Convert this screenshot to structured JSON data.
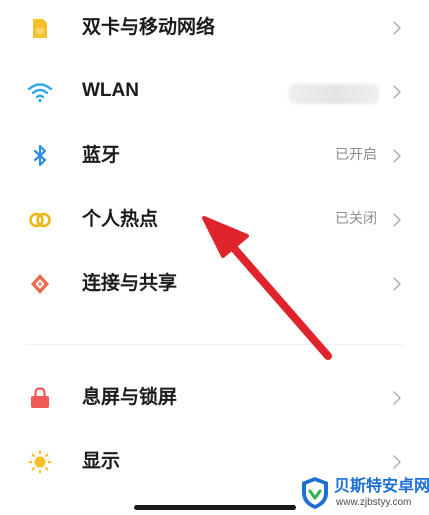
{
  "settings": {
    "items": [
      {
        "label": "双卡与移动网络",
        "status": "",
        "icon": "sim-card-icon"
      },
      {
        "label": "WLAN",
        "status": "",
        "icon": "wifi-icon"
      },
      {
        "label": "蓝牙",
        "status": "已开启",
        "icon": "bluetooth-icon"
      },
      {
        "label": "个人热点",
        "status": "已关闭",
        "icon": "hotspot-icon"
      },
      {
        "label": "连接与共享",
        "status": "",
        "icon": "connection-sharing-icon"
      },
      {
        "label": "息屏与锁屏",
        "status": "",
        "icon": "lock-icon"
      },
      {
        "label": "显示",
        "status": "",
        "icon": "sun-icon"
      }
    ]
  },
  "annotation": {
    "arrow_color": "#e0242b"
  },
  "watermark": {
    "name": "贝斯特安卓网",
    "url": "www.zjbstyy.com"
  },
  "colors": {
    "sim": "#f5c02a",
    "wifi": "#2aa8e8",
    "bluetooth": "#2c8de0",
    "hotspot": "#efb617",
    "sharing": "#ec6a4d",
    "lock": "#ef5a56",
    "sun": "#f6bf25"
  }
}
